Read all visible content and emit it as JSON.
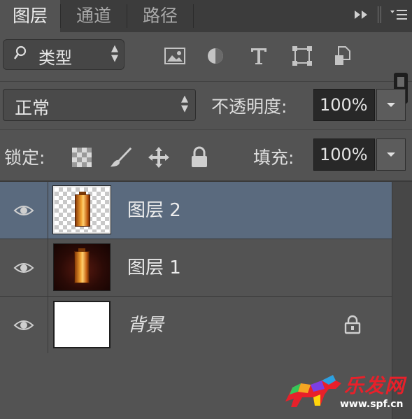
{
  "tabs": [
    {
      "label": "图层",
      "active": true
    },
    {
      "label": "通道",
      "active": false
    },
    {
      "label": "路径",
      "active": false
    }
  ],
  "tab_tools": {
    "expand_icon": "double-arrow-icon",
    "menu_icon": "panel-menu-icon"
  },
  "filter": {
    "kind_label": "类型",
    "icons": [
      "image-filter-icon",
      "adjustment-filter-icon",
      "type-filter-icon",
      "shape-filter-icon",
      "smart-object-filter-icon"
    ]
  },
  "blend": {
    "mode": "正常",
    "opacity_label": "不透明度:",
    "opacity_value": "100%"
  },
  "lock": {
    "label": "锁定:",
    "icons": [
      "lock-transparent-pixels-icon",
      "lock-image-pixels-icon",
      "lock-position-icon",
      "lock-all-icon"
    ],
    "fill_label": "填充:",
    "fill_value": "100%"
  },
  "layers": [
    {
      "name": "图层 2",
      "visible": true,
      "selected": true,
      "thumbnail": "transparent-with-lantern",
      "locked": false
    },
    {
      "name": "图层 1",
      "visible": true,
      "selected": false,
      "thumbnail": "dark-with-lantern",
      "locked": false
    },
    {
      "name": "背景",
      "visible": true,
      "selected": false,
      "thumbnail": "white",
      "locked": true,
      "italic": true
    }
  ],
  "watermark": {
    "brand": "乐发网",
    "url": "www.spf.cn"
  },
  "colors": {
    "panel_bg": "#535353",
    "tab_bar_bg": "#3c3c3c",
    "selected_layer": "#5a6a7e",
    "field_bg": "#282828",
    "watermark_red": "#e8202a"
  }
}
